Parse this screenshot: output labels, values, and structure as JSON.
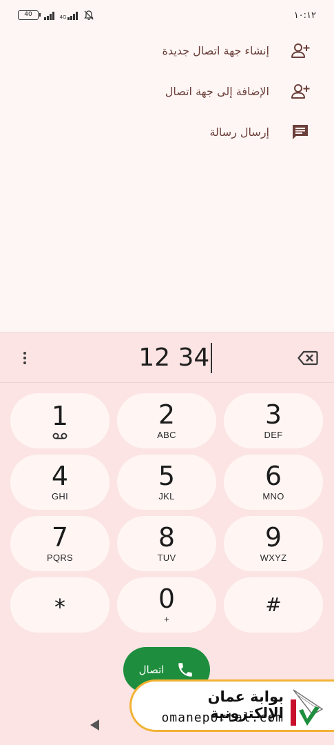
{
  "status_bar": {
    "time": "١٠:١٢",
    "battery_level": "40",
    "network_label": "4G",
    "icons": [
      "battery-icon",
      "signal-icon",
      "signal-4g-icon",
      "mute-bell-icon"
    ]
  },
  "actions": [
    {
      "label": "إنشاء جهة اتصال جديدة",
      "icon": "add-person-icon"
    },
    {
      "label": "الإضافة إلى جهة اتصال",
      "icon": "add-person-icon"
    },
    {
      "label": "إرسال رسالة",
      "icon": "message-icon"
    }
  ],
  "dialer": {
    "number": "12 34",
    "keys": [
      {
        "digit": "1",
        "letters": ""
      },
      {
        "digit": "2",
        "letters": "ABC"
      },
      {
        "digit": "3",
        "letters": "DEF"
      },
      {
        "digit": "4",
        "letters": "GHI"
      },
      {
        "digit": "5",
        "letters": "JKL"
      },
      {
        "digit": "6",
        "letters": "MNO"
      },
      {
        "digit": "7",
        "letters": "PQRS"
      },
      {
        "digit": "8",
        "letters": "TUV"
      },
      {
        "digit": "9",
        "letters": "WXYZ"
      },
      {
        "digit": "*",
        "letters": ""
      },
      {
        "digit": "0",
        "letters": "+"
      },
      {
        "digit": "#",
        "letters": ""
      }
    ],
    "call_label": "اتصال"
  },
  "watermark": {
    "title": "بوابة عمان الإلكترونية",
    "url": "omaneportal.com"
  },
  "colors": {
    "accent_text": "#6b3f3a",
    "call_green": "#1e8e3e",
    "dialer_bg": "#fbe4e3",
    "key_bg": "#fff6f4",
    "watermark_border": "#f2b233"
  }
}
